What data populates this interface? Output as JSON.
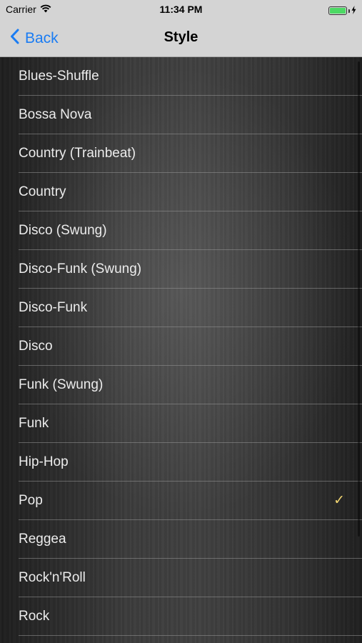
{
  "status_bar": {
    "carrier": "Carrier",
    "time": "11:34 PM",
    "icons": [
      "wifi-icon",
      "battery-icon",
      "charging-bolt-icon"
    ],
    "battery_color": "#4cd964"
  },
  "nav": {
    "back_label": "Back",
    "title": "Style",
    "accent_color": "#1a7cf3"
  },
  "styles": [
    {
      "label": "Blues-Shuffle",
      "selected": false
    },
    {
      "label": "Bossa Nova",
      "selected": false
    },
    {
      "label": "Country (Trainbeat)",
      "selected": false
    },
    {
      "label": "Country",
      "selected": false
    },
    {
      "label": "Disco (Swung)",
      "selected": false
    },
    {
      "label": "Disco-Funk (Swung)",
      "selected": false
    },
    {
      "label": "Disco-Funk",
      "selected": false
    },
    {
      "label": "Disco",
      "selected": false
    },
    {
      "label": "Funk (Swung)",
      "selected": false
    },
    {
      "label": "Funk",
      "selected": false
    },
    {
      "label": "Hip-Hop",
      "selected": false
    },
    {
      "label": "Pop",
      "selected": true
    },
    {
      "label": "Reggea",
      "selected": false
    },
    {
      "label": "Rock'n'Roll",
      "selected": false
    },
    {
      "label": "Rock",
      "selected": false
    }
  ],
  "checkmark_color": "#f2d571"
}
